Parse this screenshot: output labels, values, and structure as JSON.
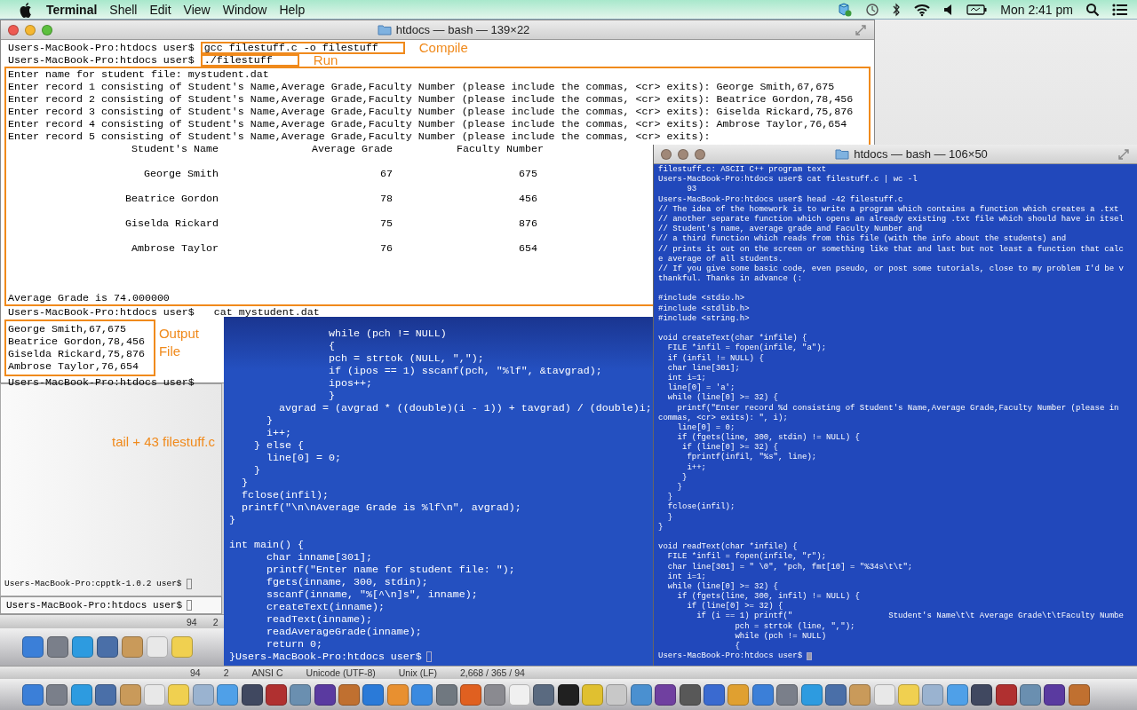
{
  "menu_bar": {
    "app_name": "Terminal",
    "menus": [
      "Shell",
      "Edit",
      "View",
      "Window",
      "Help"
    ],
    "clock": "Mon 2:41 pm"
  },
  "main_window": {
    "title": "htdocs — bash — 139×22",
    "active": true,
    "commands": [
      {
        "prompt": "Users-MacBook-Pro:htdocs user$",
        "command": "gcc filestuff.c -o filestuff",
        "annotation": "Compile"
      },
      {
        "prompt": "Users-MacBook-Pro:htdocs user$",
        "command": "./filestuff",
        "annotation": "Run"
      }
    ],
    "program_output": [
      "Enter name for student file: mystudent.dat",
      "Enter record 1 consisting of Student's Name,Average Grade,Faculty Number (please include the commas, <cr> exits): George Smith,67,675",
      "Enter record 2 consisting of Student's Name,Average Grade,Faculty Number (please include the commas, <cr> exits): Beatrice Gordon,78,456",
      "Enter record 3 consisting of Student's Name,Average Grade,Faculty Number (please include the commas, <cr> exits): Giselda Rickard,75,876",
      "Enter record 4 consisting of Student's Name,Average Grade,Faculty Number (please include the commas, <cr> exits): Ambrose Taylor,76,654",
      "Enter record 5 consisting of Student's Name,Average Grade,Faculty Number (please include the commas, <cr> exits):"
    ],
    "table": {
      "columns": [
        "Student's Name",
        "Average Grade",
        "Faculty Number"
      ],
      "rows": [
        [
          "George Smith",
          "67",
          "675"
        ],
        [
          "Beatrice Gordon",
          "78",
          "456"
        ],
        [
          "Giselda Rickard",
          "75",
          "876"
        ],
        [
          "Ambrose Taylor",
          "76",
          "654"
        ]
      ]
    },
    "result": "Average Grade is 74.000000",
    "cat_prompt": "Users-MacBook-Pro:htdocs user$",
    "cat_command": "cat mystudent.dat",
    "file_lines": [
      "George Smith,67,675",
      "Beatrice Gordon,78,456",
      "Giselda Rickard,75,876",
      "Ambrose Taylor,76,654"
    ],
    "file_annotation": "Output File",
    "end_prompt": "Users-MacBook-Pro:htdocs user$"
  },
  "back_windows": {
    "annotation": "tail + 43 filestuff.c",
    "prompts": [
      "Users-MacBook-Pro:cpptk-1.0.2 user$",
      "Users-MacBook-Pro:htdocs user$"
    ]
  },
  "code_window": {
    "blocks": [
      [
        "                while (pch != NULL)",
        "                {",
        "                pch = strtok (NULL, \",\");",
        "                if (ipos == 1) sscanf(pch, \"%lf\", &tavgrad);",
        "                ipos++;",
        "                }",
        "        avgrad = (avgrad * ((double)(i - 1)) + tavgrad) / (double)i;",
        "      }",
        "      i++;",
        "    } else {",
        "      line[0] = 0;",
        "    }",
        "  }",
        "  fclose(infil);",
        "  printf(\"\\n\\nAverage Grade is %lf\\n\", avgrad);",
        "}"
      ],
      [
        "int main() {",
        "      char inname[301];",
        "      printf(\"Enter name for student file: \");",
        "      fgets(inname, 300, stdin);",
        "      sscanf(inname, \"%[^\\n]s\", inname);",
        "      createText(inname);",
        "      readText(inname);",
        "      readAverageGrade(inname);",
        "      return 0;"
      ]
    ],
    "prompt": "}Users-MacBook-Pro:htdocs user$"
  },
  "right_window": {
    "title": "htdocs — bash — 106×50",
    "active": false,
    "blocks": [
      [
        "filestuff.c: ASCII C++ program text",
        "Users-MacBook-Pro:htdocs user$ cat filestuff.c | wc -l",
        "      93",
        "Users-MacBook-Pro:htdocs user$ head -42 filestuff.c",
        "// The idea of the homework is to write a program which contains a function which creates a .txt",
        "// another separate function which opens an already existing .txt file which should have in itsel",
        "// Student's name, average grade and Faculty Number and",
        "// a third function which reads from this file (with the info about the students) and",
        "// prints it out on the screen or something like that and last but not least a function that calc",
        "e average of all students.",
        "// If you give some basic code, even pseudo, or post some tutorials, close to my problem I'd be v",
        "thankful. Thanks in advance (:"
      ],
      [
        "#include <stdio.h>",
        "#include <stdlib.h>",
        "#include <string.h>"
      ],
      [
        "void createText(char *infile) {",
        "  FILE *infil = fopen(infile, \"a\");",
        "  if (infil != NULL) {",
        "  char line[301];",
        "  int i=1;",
        "  line[0] = 'a';",
        "  while (line[0] >= 32) {",
        "    printf(\"Enter record %d consisting of Student's Name,Average Grade,Faculty Number (please in",
        "commas, <cr> exits): \", i);",
        "    line[0] = 0;",
        "    if (fgets(line, 300, stdin) != NULL) {",
        "     if (line[0] >= 32) {",
        "      fprintf(infil, \"%s\", line);",
        "      i++;",
        "     }",
        "    }",
        "  }",
        "  fclose(infil);",
        "  }",
        "}"
      ],
      [
        "void readText(char *infile) {",
        "  FILE *infil = fopen(infile, \"r\");",
        "  char line[301] = \" \\0\", *pch, fmt[10] = \"%34s\\t\\t\";",
        "  int i=1;",
        "  while (line[0] >= 32) {",
        "    if (fgets(line, 300, infil) != NULL) {",
        "      if (line[0] >= 32) {",
        "        if (i == 1) printf(\"                    Student's Name\\t\\t Average Grade\\t\\tFaculty Numbe",
        "                pch = strtok (line, \",\");",
        "                while (pch != NULL)",
        "                {"
      ]
    ],
    "prompt": "Users-MacBook-Pro:htdocs user$"
  },
  "status_bars": [
    [
      "94",
      "2"
    ],
    [
      "94",
      "2",
      "ANSI C",
      "Unicode (UTF-8)",
      "Unix (LF)",
      "2,668 / 365 / 94"
    ]
  ]
}
